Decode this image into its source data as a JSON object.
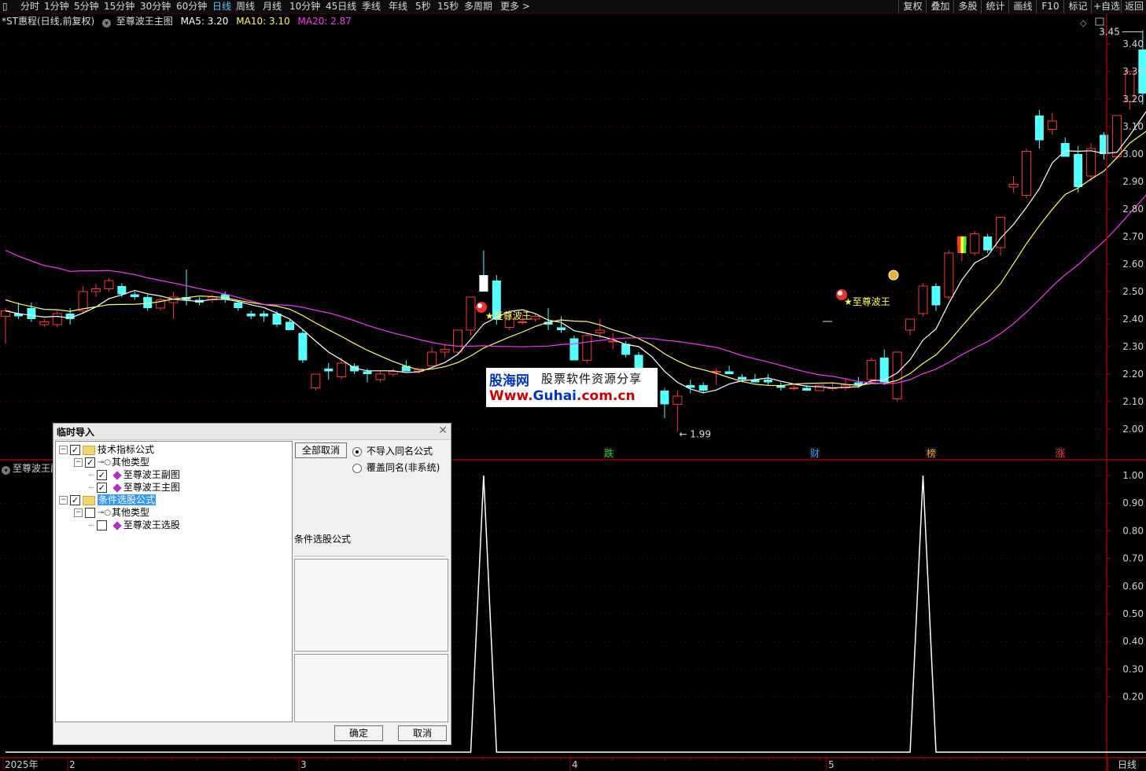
{
  "toolbar": {
    "periods": [
      "分时",
      "1分钟",
      "5分钟",
      "15分钟",
      "30分钟",
      "60分钟",
      "日线",
      "周线",
      "月线",
      "10分钟",
      "45日线",
      "季线",
      "年线",
      "5秒",
      "15秒",
      "多周期",
      "更多 >"
    ],
    "active": "日线",
    "right_tools": [
      "复权",
      "叠加",
      "多股",
      "统计",
      "画线",
      "F10",
      "标记",
      "+自选",
      "返回"
    ]
  },
  "info": {
    "stock": "*ST惠程(日线,前复权)",
    "indicator": "至尊波王主图",
    "ma5": "MA5: 3.20",
    "ma10": "MA10: 3.10",
    "ma20": "MA20: 2.87"
  },
  "colors": {
    "ma5": "#ffffff",
    "ma10": "#ffff55",
    "ma20": "#ff33ff",
    "up": "#ff3333",
    "down": "#54ffff",
    "axis": "#8b0000"
  },
  "main_axis": [
    "3.40",
    "3.30",
    "3.20",
    "3.10",
    "3.00",
    "2.90",
    "2.80",
    "2.70",
    "2.60",
    "2.50",
    "2.40",
    "2.30",
    "2.20",
    "2.10",
    "2.00"
  ],
  "sub_axis": [
    "1.00",
    "0.90",
    "0.80",
    "0.70",
    "0.60",
    "0.50",
    "0.40",
    "0.30",
    "0.20"
  ],
  "annotations": {
    "high": "3.45",
    "low": "1.99",
    "signal": "★至尊波王"
  },
  "events": [
    "跌",
    "财",
    "榜",
    "涨"
  ],
  "time_labels": [
    "2025年",
    "2",
    "3",
    "4",
    "5"
  ],
  "sub_label": "至尊波王副图",
  "bottom_period": "日线",
  "chart_data": {
    "type": "candlestick",
    "ylim": [
      1.95,
      3.47
    ],
    "candles": [
      [
        2.41,
        2.44,
        2.31,
        2.43
      ],
      [
        2.42,
        2.46,
        2.4,
        2.41
      ],
      [
        2.44,
        2.46,
        2.39,
        2.4
      ],
      [
        2.38,
        2.4,
        2.37,
        2.39
      ],
      [
        2.38,
        2.43,
        2.37,
        2.42
      ],
      [
        2.42,
        2.44,
        2.38,
        2.4
      ],
      [
        2.43,
        2.52,
        2.42,
        2.5
      ],
      [
        2.5,
        2.53,
        2.48,
        2.51
      ],
      [
        2.51,
        2.55,
        2.5,
        2.54
      ],
      [
        2.52,
        2.53,
        2.48,
        2.49
      ],
      [
        2.49,
        2.5,
        2.47,
        2.48
      ],
      [
        2.48,
        2.49,
        2.43,
        2.44
      ],
      [
        2.44,
        2.48,
        2.43,
        2.47
      ],
      [
        2.46,
        2.5,
        2.4,
        2.48
      ],
      [
        2.48,
        2.58,
        2.45,
        2.47
      ],
      [
        2.47,
        2.48,
        2.45,
        2.46
      ],
      [
        2.47,
        2.49,
        2.46,
        2.48
      ],
      [
        2.49,
        2.5,
        2.46,
        2.47
      ],
      [
        2.46,
        2.47,
        2.43,
        2.44
      ],
      [
        2.42,
        2.43,
        2.4,
        2.41
      ],
      [
        2.42,
        2.43,
        2.39,
        2.41
      ],
      [
        2.42,
        2.43,
        2.37,
        2.38
      ],
      [
        2.39,
        2.4,
        2.36,
        2.36
      ],
      [
        2.35,
        2.36,
        2.24,
        2.25
      ],
      [
        2.15,
        2.2,
        2.14,
        2.2
      ],
      [
        2.22,
        2.24,
        2.18,
        2.21
      ],
      [
        2.19,
        2.26,
        2.18,
        2.24
      ],
      [
        2.23,
        2.24,
        2.2,
        2.21
      ],
      [
        2.21,
        2.22,
        2.17,
        2.2
      ],
      [
        2.18,
        2.21,
        2.17,
        2.2
      ],
      [
        2.2,
        2.22,
        2.19,
        2.21
      ],
      [
        2.23,
        2.25,
        2.21,
        2.21
      ],
      [
        2.21,
        2.22,
        2.2,
        2.22
      ],
      [
        2.23,
        2.3,
        2.22,
        2.28
      ],
      [
        2.28,
        2.31,
        2.26,
        2.29
      ],
      [
        2.28,
        2.36,
        2.27,
        2.36
      ],
      [
        2.36,
        2.48,
        2.34,
        2.48
      ],
      [
        2.56,
        2.65,
        2.5,
        2.5
      ],
      [
        2.54,
        2.56,
        2.38,
        2.4
      ],
      [
        2.37,
        2.42,
        2.36,
        2.4
      ],
      [
        2.39,
        2.42,
        2.38,
        2.39
      ],
      [
        2.4,
        2.42,
        2.39,
        2.41
      ],
      [
        2.39,
        2.44,
        2.36,
        2.38
      ],
      [
        2.37,
        2.41,
        2.35,
        2.36
      ],
      [
        2.33,
        2.34,
        2.25,
        2.25
      ],
      [
        2.25,
        2.35,
        2.24,
        2.34
      ],
      [
        2.35,
        2.4,
        2.33,
        2.36
      ],
      [
        2.32,
        2.35,
        2.29,
        2.32
      ],
      [
        2.31,
        2.32,
        2.26,
        2.27
      ],
      [
        2.27,
        2.28,
        2.2,
        2.21
      ],
      [
        2.2,
        2.21,
        2.15,
        2.16
      ],
      [
        2.14,
        2.15,
        2.04,
        2.09
      ],
      [
        2.09,
        2.14,
        1.99,
        2.12
      ],
      [
        2.16,
        2.18,
        2.13,
        2.15
      ],
      [
        2.16,
        2.17,
        2.13,
        2.14
      ],
      [
        2.21,
        2.22,
        2.16,
        2.21
      ],
      [
        2.21,
        2.23,
        2.2,
        2.2
      ],
      [
        2.19,
        2.2,
        2.17,
        2.18
      ],
      [
        2.18,
        2.2,
        2.17,
        2.17
      ],
      [
        2.18,
        2.2,
        2.16,
        2.17
      ],
      [
        2.16,
        2.17,
        2.14,
        2.15
      ],
      [
        2.15,
        2.16,
        2.14,
        2.15
      ],
      [
        2.15,
        2.16,
        2.14,
        2.14
      ],
      [
        2.14,
        2.16,
        2.14,
        2.16
      ],
      [
        2.15,
        2.17,
        2.14,
        2.15
      ],
      [
        2.15,
        2.18,
        2.14,
        2.16
      ],
      [
        2.17,
        2.19,
        2.15,
        2.16
      ],
      [
        2.18,
        2.26,
        2.17,
        2.25
      ],
      [
        2.26,
        2.29,
        2.16,
        2.17
      ],
      [
        2.11,
        2.28,
        2.1,
        2.28
      ],
      [
        2.36,
        2.4,
        2.34,
        2.4
      ],
      [
        2.42,
        2.53,
        2.41,
        2.52
      ],
      [
        2.52,
        2.53,
        2.43,
        2.45
      ],
      [
        2.48,
        2.65,
        2.47,
        2.64
      ],
      [
        2.67,
        2.7,
        2.61,
        2.7
      ],
      [
        2.64,
        2.72,
        2.63,
        2.71
      ],
      [
        2.7,
        2.71,
        2.64,
        2.65
      ],
      [
        2.66,
        2.77,
        2.63,
        2.77
      ],
      [
        2.88,
        2.92,
        2.86,
        2.89
      ],
      [
        2.85,
        3.02,
        2.84,
        3.01
      ],
      [
        3.14,
        3.16,
        3.02,
        3.05
      ],
      [
        3.09,
        3.15,
        3.07,
        3.12
      ],
      [
        3.04,
        3.06,
        2.99,
        2.99
      ],
      [
        3.0,
        3.03,
        2.86,
        2.88
      ],
      [
        2.92,
        3.04,
        2.9,
        3.02
      ],
      [
        3.07,
        3.08,
        2.98,
        3.0
      ],
      [
        2.99,
        3.14,
        2.98,
        3.14
      ],
      [
        3.19,
        3.3,
        3.16,
        3.3
      ],
      [
        3.38,
        3.45,
        3.18,
        3.22
      ],
      [
        3.22,
        3.38,
        3.2,
        3.37
      ]
    ],
    "ma5_end": 3.2,
    "ma10_end": 3.1,
    "ma20_end": 2.87,
    "sub_peaks": [
      37,
      71
    ]
  },
  "dialog": {
    "title": "临时导入",
    "tree": [
      {
        "label": "技术指标公式",
        "level": 0,
        "expand": "⊟",
        "checked": true,
        "type": "folder"
      },
      {
        "label": "其他类型",
        "level": 1,
        "expand": "⊟",
        "checked": true,
        "type": "key"
      },
      {
        "label": "至尊波王副图",
        "level": 2,
        "checked": true,
        "type": "gem"
      },
      {
        "label": "至尊波王主图",
        "level": 2,
        "checked": true,
        "type": "gem"
      },
      {
        "label": "条件选股公式",
        "level": 0,
        "expand": "⊟",
        "checked": true,
        "type": "folder",
        "selected": true
      },
      {
        "label": "其他类型",
        "level": 1,
        "expand": "⊟",
        "checked": false,
        "type": "key"
      },
      {
        "label": "至尊波王选股",
        "level": 2,
        "checked": false,
        "type": "gem"
      }
    ],
    "cancel_all": "全部取消",
    "radio_no_import": "不导入同名公式",
    "radio_overwrite": "覆盖同名(非系统)",
    "category_label": "条件选股公式",
    "ok": "确定",
    "cancel": "取消"
  },
  "watermark": {
    "logo": "股海网",
    "tag": "股票软件资源分享",
    "url_prefix": "Www.",
    "url_mid": "Guhai",
    "url_suffix": ".com.cn"
  }
}
